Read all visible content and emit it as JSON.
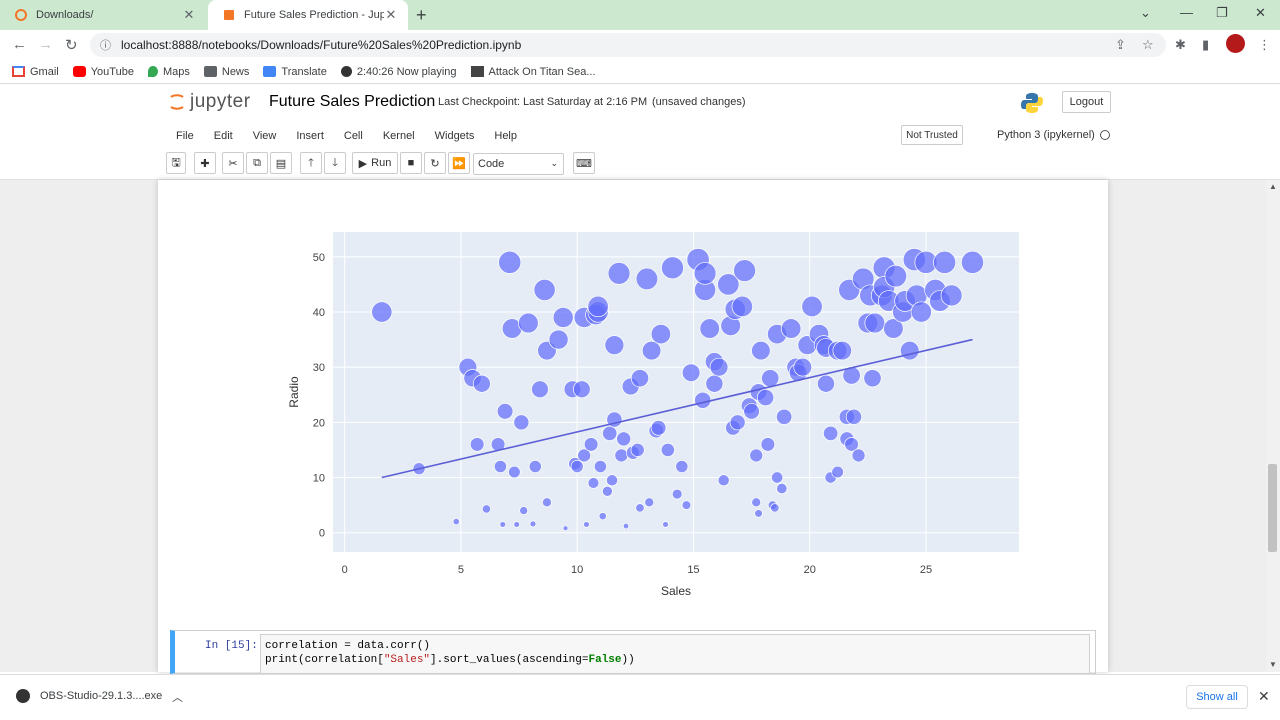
{
  "browser": {
    "tabs": [
      {
        "title": "Downloads/",
        "active": false
      },
      {
        "title": "Future Sales Prediction - Jupyter",
        "active": true
      }
    ],
    "url": "localhost:8888/notebooks/Downloads/Future%20Sales%20Prediction.ipynb",
    "bookmarks": [
      "Gmail",
      "YouTube",
      "Maps",
      "News",
      "Translate",
      "2:40:26 Now playing",
      "Attack On Titan Sea..."
    ]
  },
  "jupyter": {
    "logo_text": "jupyter",
    "notebook_title": "Future Sales Prediction",
    "checkpoint": "Last Checkpoint: Last Saturday at 2:16 PM",
    "unsaved": "(unsaved changes)",
    "logout": "Logout",
    "menu": [
      "File",
      "Edit",
      "View",
      "Insert",
      "Cell",
      "Kernel",
      "Widgets",
      "Help"
    ],
    "trusted": "Not Trusted",
    "kernel_name": "Python 3 (ipykernel)",
    "run_label": "Run",
    "cell_type": "Code"
  },
  "cell": {
    "prompt": "In [15]:",
    "code_line1": "correlation = data.corr()",
    "code_line2_pre": "print(correlation[",
    "code_line2_str": "\"Sales\"",
    "code_line2_mid": "].sort_values(ascending=",
    "code_line2_kw": "False",
    "code_line2_post": "))"
  },
  "download": {
    "filename": "OBS-Studio-29.1.3....exe",
    "show_all": "Show all"
  },
  "colors": {
    "marker": "#636efa",
    "plot_bg": "#e5ecf6",
    "trend": "#5b5ed6",
    "tab_strip": "#cce8cf"
  },
  "chart_data": {
    "type": "scatter",
    "xlabel": "Sales",
    "ylabel": "Radio",
    "xlim": [
      -0.5,
      29
    ],
    "ylim": [
      -3.5,
      54.5
    ],
    "x_ticks": [
      0,
      5,
      10,
      15,
      20,
      25
    ],
    "y_ticks": [
      0,
      10,
      20,
      30,
      40,
      50
    ],
    "size_encoding": "marker size grows with Radio",
    "trendline": {
      "x": [
        1.6,
        27.0
      ],
      "y": [
        10.0,
        35.0
      ]
    },
    "points": [
      [
        1.6,
        40
      ],
      [
        3.2,
        11.6
      ],
      [
        4.8,
        2
      ],
      [
        5.3,
        30
      ],
      [
        5.5,
        28
      ],
      [
        5.7,
        16
      ],
      [
        5.9,
        27
      ],
      [
        6.1,
        4.3
      ],
      [
        6.6,
        16
      ],
      [
        6.7,
        12
      ],
      [
        6.8,
        1.5
      ],
      [
        6.9,
        22
      ],
      [
        7.1,
        49
      ],
      [
        7.2,
        37
      ],
      [
        7.3,
        11
      ],
      [
        7.4,
        1.5
      ],
      [
        7.6,
        20
      ],
      [
        7.7,
        4
      ],
      [
        7.9,
        38
      ],
      [
        8.1,
        1.6
      ],
      [
        8.2,
        12
      ],
      [
        8.4,
        26
      ],
      [
        8.6,
        44
      ],
      [
        8.7,
        5.5
      ],
      [
        8.7,
        33
      ],
      [
        9.2,
        35
      ],
      [
        9.4,
        39
      ],
      [
        9.5,
        0.8
      ],
      [
        9.8,
        26
      ],
      [
        9.9,
        12.5
      ],
      [
        10,
        12
      ],
      [
        10.2,
        26
      ],
      [
        10.3,
        39
      ],
      [
        10.3,
        14
      ],
      [
        10.4,
        1.5
      ],
      [
        10.6,
        16
      ],
      [
        10.7,
        9
      ],
      [
        10.8,
        39.5
      ],
      [
        10.9,
        40
      ],
      [
        10.9,
        41
      ],
      [
        11,
        12
      ],
      [
        11.1,
        3
      ],
      [
        11.3,
        7.5
      ],
      [
        11.4,
        18
      ],
      [
        11.5,
        9.5
      ],
      [
        11.6,
        20.5
      ],
      [
        11.6,
        34
      ],
      [
        11.8,
        47
      ],
      [
        11.9,
        14
      ],
      [
        12,
        17
      ],
      [
        12.1,
        1.2
      ],
      [
        12.3,
        26.5
      ],
      [
        12.4,
        14.5
      ],
      [
        12.6,
        15
      ],
      [
        12.7,
        28
      ],
      [
        12.7,
        4.5
      ],
      [
        13,
        46
      ],
      [
        13.1,
        5.5
      ],
      [
        13.2,
        33
      ],
      [
        13.4,
        18.5
      ],
      [
        13.5,
        19
      ],
      [
        13.6,
        36
      ],
      [
        13.8,
        1.5
      ],
      [
        13.9,
        15
      ],
      [
        14.1,
        48
      ],
      [
        14.3,
        7
      ],
      [
        14.5,
        12
      ],
      [
        14.7,
        5
      ],
      [
        14.9,
        29
      ],
      [
        15.2,
        49.5
      ],
      [
        15.4,
        24
      ],
      [
        15.5,
        44
      ],
      [
        15.5,
        47
      ],
      [
        15.7,
        37
      ],
      [
        15.9,
        27
      ],
      [
        15.9,
        31
      ],
      [
        16.1,
        30
      ],
      [
        16.3,
        9.5
      ],
      [
        16.5,
        45
      ],
      [
        16.6,
        37.5
      ],
      [
        16.7,
        19
      ],
      [
        16.8,
        40.5
      ],
      [
        16.9,
        20
      ],
      [
        17.1,
        41
      ],
      [
        17.2,
        47.5
      ],
      [
        17.4,
        23
      ],
      [
        17.5,
        22
      ],
      [
        17.7,
        14
      ],
      [
        17.7,
        5.5
      ],
      [
        17.8,
        25.5
      ],
      [
        17.8,
        3.5
      ],
      [
        17.9,
        33
      ],
      [
        18.1,
        24.5
      ],
      [
        18.2,
        16
      ],
      [
        18.3,
        28
      ],
      [
        18.4,
        5
      ],
      [
        18.5,
        4.5
      ],
      [
        18.6,
        36
      ],
      [
        18.6,
        10
      ],
      [
        18.8,
        8
      ],
      [
        18.9,
        21
      ],
      [
        19.2,
        37
      ],
      [
        19.4,
        30
      ],
      [
        19.5,
        29
      ],
      [
        19.7,
        30
      ],
      [
        19.9,
        34
      ],
      [
        20.1,
        41
      ],
      [
        20.4,
        36
      ],
      [
        20.6,
        34
      ],
      [
        20.7,
        33.5
      ],
      [
        20.7,
        27
      ],
      [
        20.9,
        18
      ],
      [
        20.9,
        10
      ],
      [
        21.2,
        11
      ],
      [
        21.2,
        33
      ],
      [
        21.4,
        33
      ],
      [
        21.6,
        17
      ],
      [
        21.6,
        21
      ],
      [
        21.7,
        44
      ],
      [
        21.8,
        28.5
      ],
      [
        21.8,
        16
      ],
      [
        21.9,
        21
      ],
      [
        22.1,
        14
      ],
      [
        22.3,
        46
      ],
      [
        22.5,
        38
      ],
      [
        22.6,
        43
      ],
      [
        22.7,
        28
      ],
      [
        22.8,
        38
      ],
      [
        23.1,
        43
      ],
      [
        23.2,
        48
      ],
      [
        23.2,
        44.5
      ],
      [
        23.4,
        42
      ],
      [
        23.6,
        37
      ],
      [
        23.7,
        46.5
      ],
      [
        24,
        40
      ],
      [
        24.1,
        42
      ],
      [
        24.3,
        33
      ],
      [
        24.5,
        49.5
      ],
      [
        24.6,
        43
      ],
      [
        24.8,
        40
      ],
      [
        25,
        49
      ],
      [
        25.4,
        44
      ],
      [
        25.6,
        42
      ],
      [
        25.8,
        49
      ],
      [
        26.1,
        43
      ],
      [
        27,
        49
      ]
    ]
  }
}
